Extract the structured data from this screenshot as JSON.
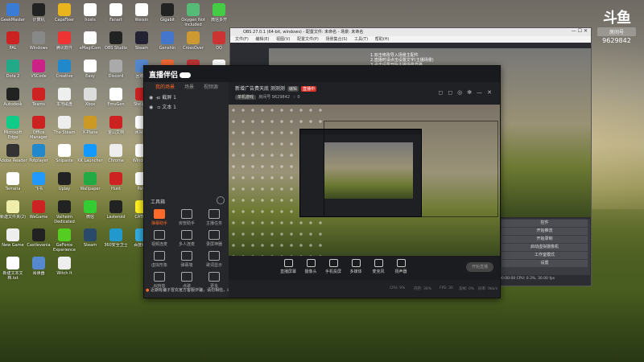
{
  "watermark": {
    "logo": "斗鱼",
    "badge": "房间号",
    "room_id": "9629842"
  },
  "desktop_icons": [
    {
      "label": "GeekMaster",
      "color": "#3a7bd5"
    },
    {
      "label": "计算机",
      "color": "#222"
    },
    {
      "label": "CapsFixer",
      "color": "#e9b51f"
    },
    {
      "label": "hosts",
      "color": "#fff"
    },
    {
      "label": "Fanart",
      "color": "#fff"
    },
    {
      "label": "Weixin",
      "color": "#fff"
    },
    {
      "label": "Gigabit",
      "color": "#222"
    },
    {
      "label": "Oxygen Not Included",
      "color": "#5b7"
    },
    {
      "label": "微信多开",
      "color": "#4c4"
    },
    {
      "label": "PAL",
      "color": "#c22"
    },
    {
      "label": "Windows",
      "color": "#888"
    },
    {
      "label": "腾讯软件",
      "color": "#e33"
    },
    {
      "label": "eMagiCom",
      "color": "#fff"
    },
    {
      "label": "OBS Studio",
      "color": "#222"
    },
    {
      "label": "Steam",
      "color": "#223"
    },
    {
      "label": "Genshin",
      "color": "#47c"
    },
    {
      "label": "CrossOver",
      "color": "#c93"
    },
    {
      "label": "QQ",
      "color": "#c33"
    },
    {
      "label": "Dota 2",
      "color": "#2a8"
    },
    {
      "label": "VSCode",
      "color": "#c28"
    },
    {
      "label": "Creative",
      "color": "#28c"
    },
    {
      "label": "Easy",
      "color": "#fff"
    },
    {
      "label": "Discord",
      "color": "#aaa"
    },
    {
      "label": "回收站",
      "color": "#58c"
    },
    {
      "label": "Thunder",
      "color": "#e63"
    },
    {
      "label": "网易云音乐",
      "color": "#b33"
    },
    {
      "label": "Adobe",
      "color": "#fff"
    },
    {
      "label": "Autodesk",
      "color": "#222"
    },
    {
      "label": "Teams",
      "color": "#c22"
    },
    {
      "label": "本地磁盘",
      "color": "#eee"
    },
    {
      "label": "Xbox",
      "color": "#ddd"
    },
    {
      "label": "EmuGen",
      "color": "#fff"
    },
    {
      "label": "Stellaris",
      "color": "#c22"
    },
    {
      "label": "Parsec",
      "color": "#333"
    },
    {
      "label": "Oscar",
      "color": "#222"
    },
    {
      "label": "Internet Explorer",
      "color": "#19c"
    },
    {
      "label": "Microsoft Edge",
      "color": "#1c8"
    },
    {
      "label": "Office Manager",
      "color": "#c22"
    },
    {
      "label": "The Steam",
      "color": "#eee"
    },
    {
      "label": "X-Plane",
      "color": "#c92"
    },
    {
      "label": "金山文档",
      "color": "#c22"
    },
    {
      "label": "网易UU",
      "color": "#fff"
    },
    {
      "label": "BiliBili",
      "color": "#b2c"
    },
    {
      "label": "Cyberpunk",
      "color": "#ccc"
    },
    {
      "label": "控制面板",
      "color": "#48c"
    },
    {
      "label": "Adobe Reader",
      "color": "#333"
    },
    {
      "label": "Potplayer",
      "color": "#28c"
    },
    {
      "label": "Snipaste",
      "color": "#fff"
    },
    {
      "label": "KK Launcher",
      "color": "#19f"
    },
    {
      "label": "Chrome",
      "color": "#eee"
    },
    {
      "label": "Windows",
      "color": "#fff"
    },
    {
      "label": "Epic",
      "color": "#fff"
    },
    {
      "label": "Arena",
      "color": "#c82"
    },
    {
      "label": "Lark",
      "color": "#fff"
    },
    {
      "label": "Terraria",
      "color": "#fff"
    },
    {
      "label": "飞书",
      "color": "#29f"
    },
    {
      "label": "Uplay",
      "color": "#222"
    },
    {
      "label": "Wallpaper",
      "color": "#2a4"
    },
    {
      "label": "Hunt",
      "color": "#c22"
    },
    {
      "label": "Path",
      "color": "#fff"
    },
    {
      "label": "斗鱼直播伴侣",
      "color": "#e82"
    },
    {
      "label": "DirectX修复",
      "color": "#28c"
    },
    {
      "label": "Hoboi Tough Life",
      "color": "#a74"
    },
    {
      "label": "新建文件夹(2)",
      "color": "#eea"
    },
    {
      "label": "WeGame",
      "color": "#c22"
    },
    {
      "label": "Valheim Dedicated",
      "color": "#222"
    },
    {
      "label": "微信",
      "color": "#3c3"
    },
    {
      "label": "Lasteroid",
      "color": "#222"
    },
    {
      "label": "CATHO",
      "color": "#fe2"
    },
    {
      "label": "Bulletins Path",
      "color": "#c33"
    },
    {
      "label": "Tent",
      "color": "#eee"
    },
    {
      "label": "The Devil",
      "color": "#49c"
    },
    {
      "label": "New Game",
      "color": "#eee"
    },
    {
      "label": "Castlevania",
      "color": "#222"
    },
    {
      "label": "GeForce Experience",
      "color": "#5c2"
    },
    {
      "label": "Steam",
      "color": "#2a4a6a"
    },
    {
      "label": "360安全卫士",
      "color": "#29c"
    },
    {
      "label": "百度网盘",
      "color": "#3ad"
    },
    {
      "label": "电脑管家",
      "color": "#1ad"
    },
    {
      "label": "Gun",
      "color": "#eee"
    },
    {
      "label": "Teamfight Manager",
      "color": "#eee"
    },
    {
      "label": "新建文本文档.txt",
      "color": "#fff"
    },
    {
      "label": "阅读器",
      "color": "#58c"
    },
    {
      "label": "Witch It",
      "color": "#eee"
    }
  ],
  "obs": {
    "title": "OBS 27.0.1 (64-bit, windows) - 配置文件: 未命名 - 场景: 未命名",
    "menu": [
      "文件(F)",
      "编辑(E)",
      "视图(V)",
      "配置文件(P)",
      "场景集合(S)",
      "工具(T)",
      "帮助(H)"
    ],
    "window_controls": "—  ☐  ✕",
    "overlay_text": [
      "1.双击修改导入场景主配件",
      "2.直播时请点击设置文字(主播场景)",
      "3.点击设置开始主播场景直播"
    ],
    "controls": [
      "控件",
      "开始推流",
      "开始录制",
      "启动虚拟摄像机",
      "工作室模式",
      "设置",
      "退出"
    ],
    "status": "00:00:00   CPU: 0.3%, 30.00 fps"
  },
  "app": {
    "logo": "直播伴侣",
    "tabs": [
      "我的场景",
      "场景",
      "视频源"
    ],
    "scenes": [
      {
        "label": "截屏 1"
      },
      {
        "label": "文本 1"
      }
    ],
    "tools_title": "工具箱",
    "tools": [
      {
        "label": "弹幕助手",
        "hot": true
      },
      {
        "label": "房管助手",
        "hot": false
      },
      {
        "label": "主播任务",
        "hot": false
      },
      {
        "label": "视频连麦",
        "hot": false
      },
      {
        "label": "多人连麦",
        "hot": false
      },
      {
        "label": "录屏神器",
        "hot": false
      },
      {
        "label": "虚拟形象",
        "hot": false
      },
      {
        "label": "弹幕墙",
        "hot": false
      },
      {
        "label": "歌词显示",
        "hot": false
      },
      {
        "label": "Ai特效",
        "hot": false
      },
      {
        "label": "点歌",
        "hot": false
      },
      {
        "label": "更多",
        "hot": false
      }
    ],
    "notice": "近期有骗子冒充官方客服诈骗，请勿相信，以免造成财产损失",
    "room": {
      "title": "新增广告费天底 测测测",
      "tag_edit": "编辑",
      "tag_live": "直播中",
      "category": "单机游戏",
      "meta": "房间号 9629842",
      "fans": "0"
    },
    "header_icons": [
      "gift-icon",
      "chat-icon",
      "share-icon",
      "settings-icon",
      "minimize-icon",
      "close-icon"
    ],
    "bottom_items": [
      "直播屏幕",
      "摄像头",
      "手机投屏",
      "多媒体",
      "麦克风",
      "扬声器"
    ],
    "go_live": "开始直播",
    "status_items": [
      "CPU: 9%",
      "内存: 30%",
      "FPS: 30",
      "丢帧: 0%",
      "码率: 0kb/s"
    ]
  }
}
